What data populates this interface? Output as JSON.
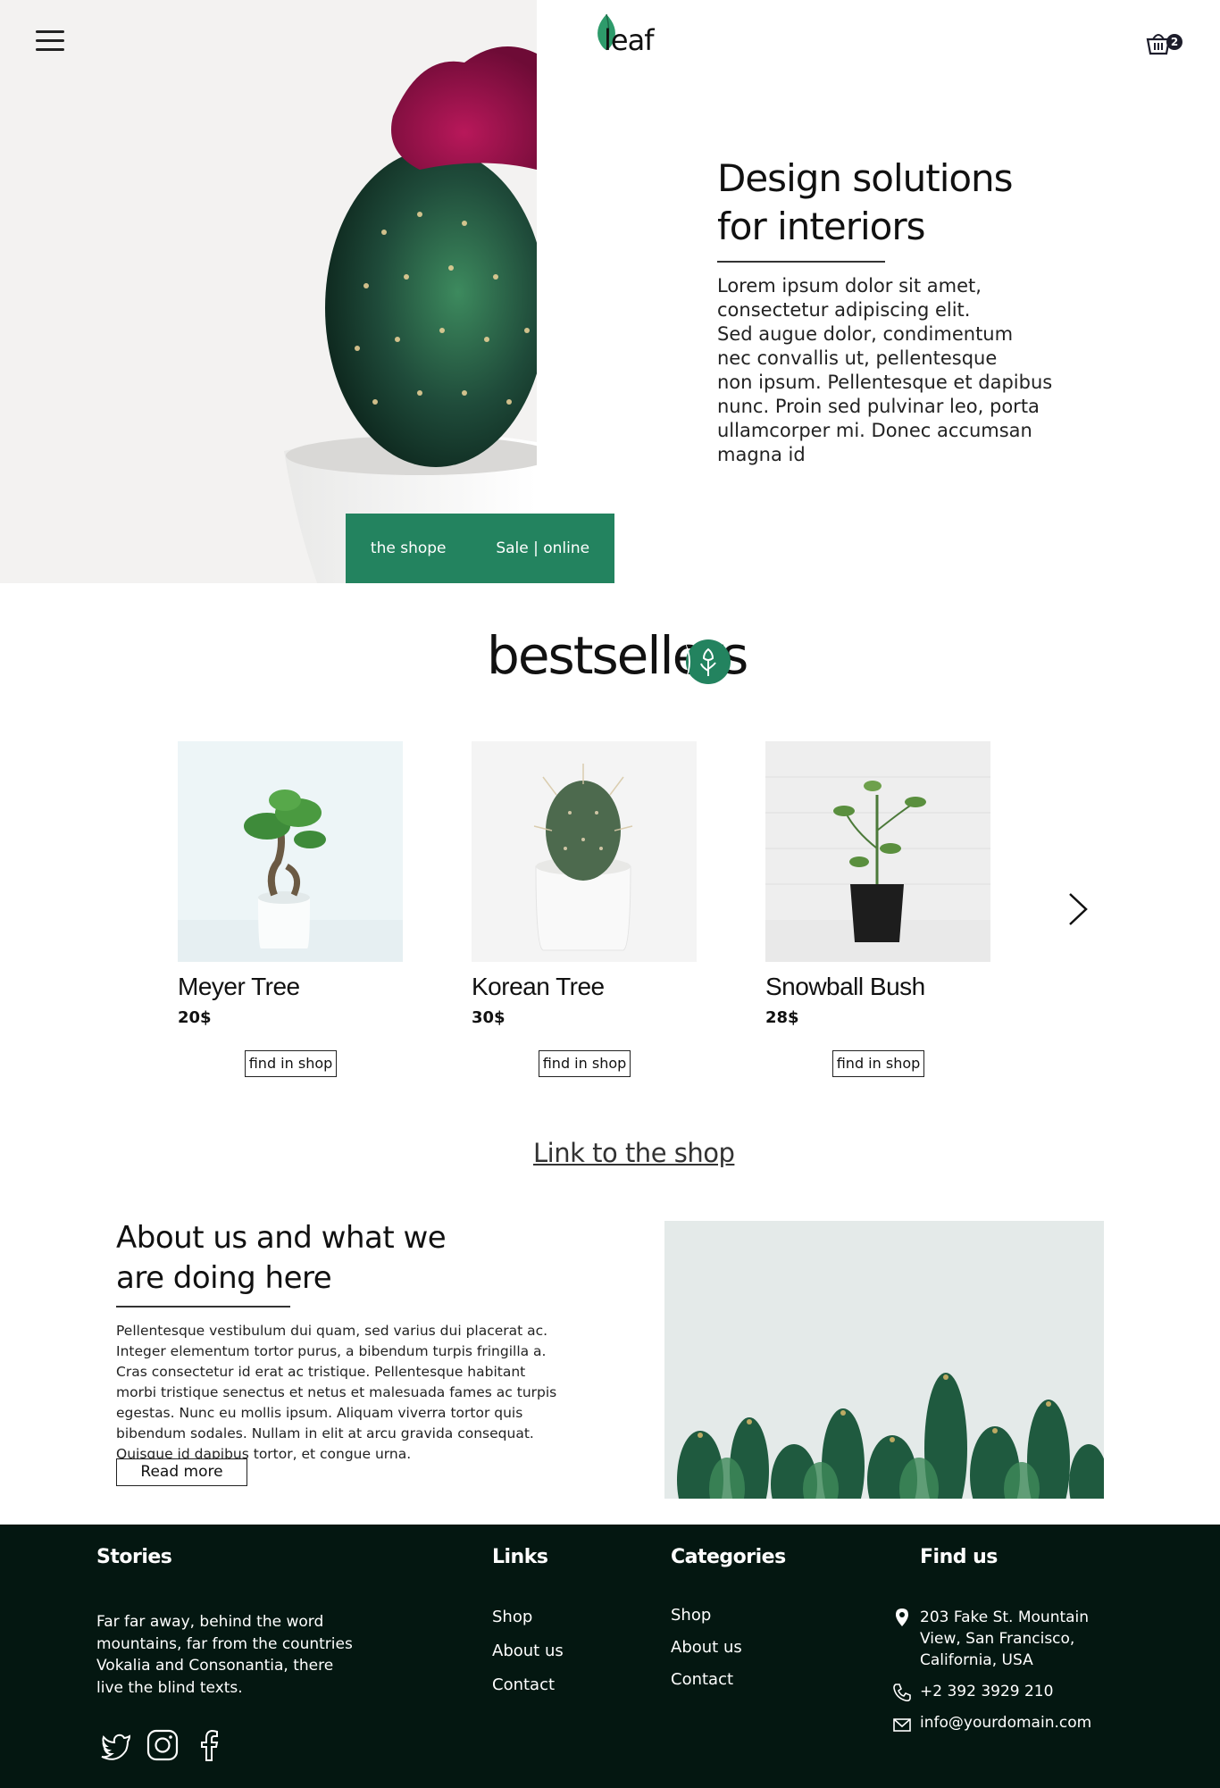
{
  "header": {
    "logo_text": "leaf",
    "cart_count": "2"
  },
  "hero": {
    "title": "Design solutions for interiors",
    "text": "Lorem ipsum dolor sit amet,\nconsectetur adipiscing elit.\nSed augue dolor, condimentum\nnec convallis ut, pellentesque\nnon ipsum. Pellentesque et dapibus\nnunc. Proin sed pulvinar leo, porta\nullamcorper mi. Donec accumsan magna id",
    "cta_left": "the shope",
    "cta_right": "Sale | online"
  },
  "bestsellers": {
    "title": "bestsellers",
    "products": [
      {
        "name": "Meyer Tree",
        "price": "20$",
        "button": "find in shop"
      },
      {
        "name": "Korean Tree",
        "price": "30$",
        "button": "find in shop"
      },
      {
        "name": "Snowball Bush",
        "price": "28$",
        "button": "find in shop"
      }
    ],
    "shop_link": "Link to the shop"
  },
  "about": {
    "title": "About us and what we are doing here",
    "text": "Pellentesque vestibulum dui quam, sed varius dui placerat ac. Integer elementum tortor purus, a bibendum turpis fringilla a. Cras consectetur id erat ac tristique. Pellentesque habitant morbi tristique senectus et netus et malesuada fames ac turpis egestas. Nunc eu mollis ipsum. Aliquam viverra tortor quis bibendum sodales. Nullam in elit at arcu gravida consequat. Quisque id dapibus tortor, et congue urna.",
    "button": "Read more"
  },
  "footer": {
    "stories": {
      "heading": "Stories",
      "text": "Far far away, behind the word mountains, far from the countries Vokalia and Consonantia, there live the blind texts."
    },
    "links": {
      "heading": "Links",
      "items": [
        "Shop",
        "About us",
        "Contact"
      ]
    },
    "categories": {
      "heading": "Categories",
      "items": [
        "Shop",
        "About us",
        "Contact"
      ]
    },
    "find_us": {
      "heading": "Find us",
      "address": "203 Fake St. Mountain View, San Francisco, California, USA",
      "phone": "+2 392 3929 210",
      "email": "info@yourdomain.com"
    },
    "social_icons": [
      "twitter-icon",
      "instagram-icon",
      "facebook-icon"
    ]
  },
  "colors": {
    "brand_green": "#23835f",
    "footer_bg": "#041711"
  }
}
